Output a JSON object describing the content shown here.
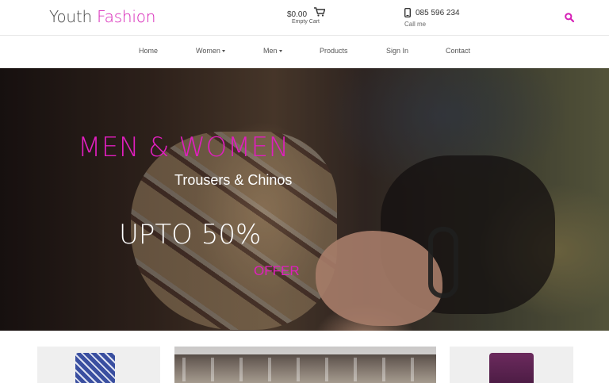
{
  "brand": {
    "part1": "Youth",
    "part2": "Fashion",
    "accent": "#d61fb6"
  },
  "cart": {
    "amount": "$0.00",
    "label": "Empty Cart",
    "icon": "cart-icon"
  },
  "contact": {
    "phone": "085 596 234",
    "label": "Call me",
    "icon": "phone-icon"
  },
  "search": {
    "icon": "search-icon"
  },
  "nav": {
    "items": [
      {
        "label": "Home",
        "dropdown": false
      },
      {
        "label": "Women",
        "dropdown": true
      },
      {
        "label": "Men",
        "dropdown": true
      },
      {
        "label": "Products",
        "dropdown": false
      },
      {
        "label": "Sign In",
        "dropdown": false
      },
      {
        "label": "Contact",
        "dropdown": false
      }
    ]
  },
  "hero": {
    "title": "MEN & WOMEN",
    "subtitle": "Trousers & Chinos",
    "offer": "UPTO 50%",
    "offer_label": "OFFER",
    "title_color": "#e01fbe"
  }
}
